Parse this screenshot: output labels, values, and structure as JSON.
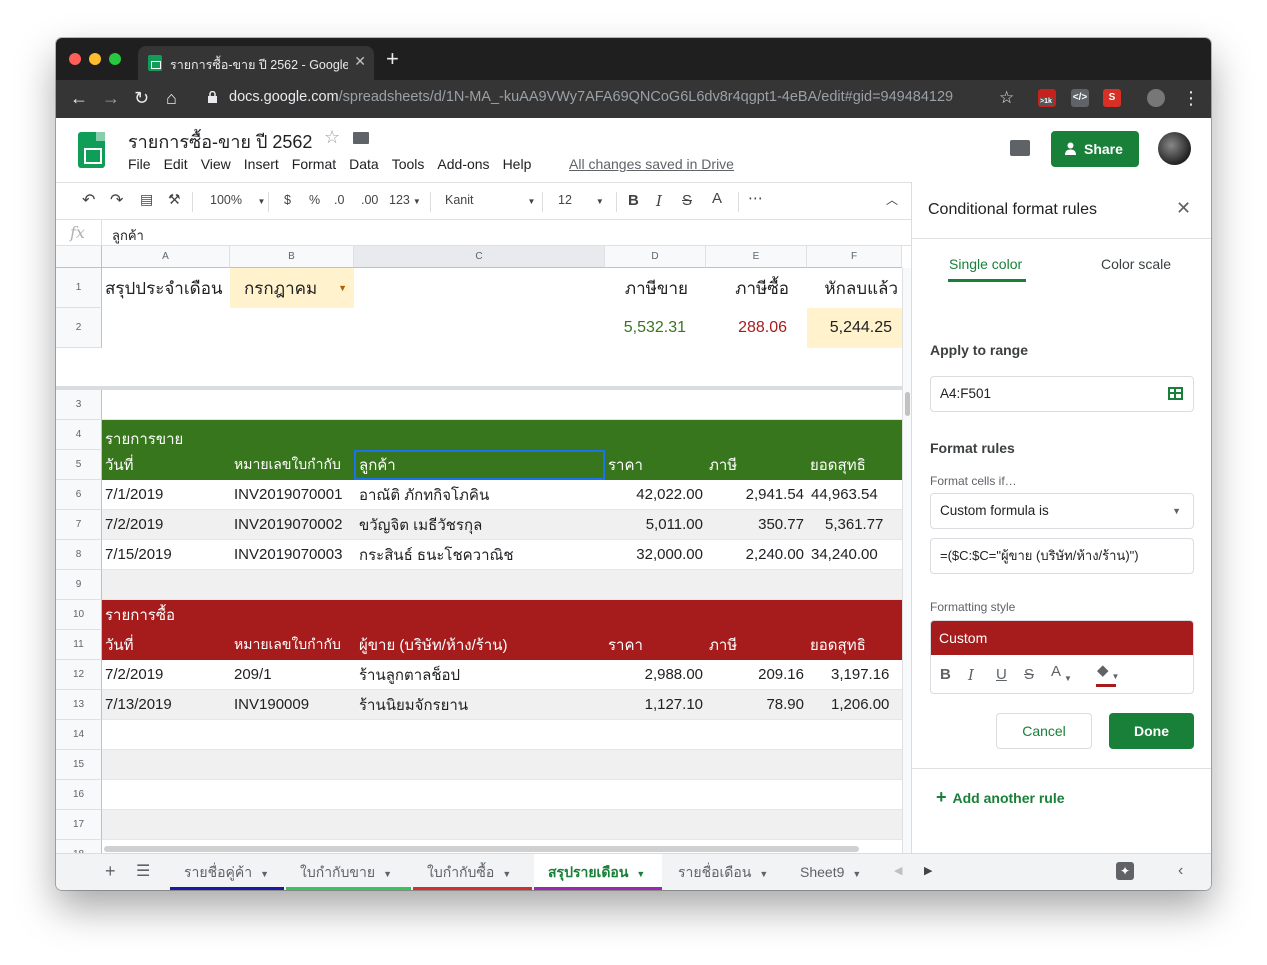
{
  "browser": {
    "tab_title": "รายการซื้อ-ขาย ปี 2562 - Google",
    "url_host": "docs.google.com",
    "url_path": "/spreadsheets/d/1N-MA_-kuAA9VWy7AFA69QNCoG6L6dv8r4qgpt1-4eBA/edit#gid=949484129",
    "ext_badge": ">1k"
  },
  "doc": {
    "title": "รายการซื้อ-ขาย ปี 2562",
    "menus": [
      "File",
      "Edit",
      "View",
      "Insert",
      "Format",
      "Data",
      "Tools",
      "Add-ons",
      "Help"
    ],
    "saved_status": "All changes saved in Drive",
    "share_label": "Share"
  },
  "toolbar": {
    "zoom": "100%",
    "currency": "$",
    "percent": "%",
    "dec_less": ".0",
    "dec_more": ".00",
    "format_more": "123",
    "font": "Kanit",
    "font_size": "12",
    "more": "⋯"
  },
  "formula_bar": {
    "fx": "fx",
    "value": "ลูกค้า"
  },
  "columns": [
    "A",
    "B",
    "C",
    "D",
    "E",
    "F"
  ],
  "rows": {
    "r1": {
      "a": "สรุปประจำเดือน",
      "b": "กรกฎาคม",
      "d": "ภาษีขาย",
      "e": "ภาษีซื้อ",
      "f": "หักลบแล้ว"
    },
    "r2": {
      "d": "5,532.31",
      "e": "288.06",
      "f": "5,244.25"
    },
    "r4": {
      "a": "รายการขาย"
    },
    "r5": {
      "a": "วันที่",
      "b": "หมายเลขใบกำกับ",
      "c": "ลูกค้า",
      "d": "ราคา",
      "e": "ภาษี",
      "f": "ยอดสุทธิ"
    },
    "r6": {
      "a": "7/1/2019",
      "b": "INV2019070001",
      "c": "อาณัติ ภักทกิจโภคิน",
      "d": "42,022.00",
      "e": "2,941.54",
      "f": "44,963.54"
    },
    "r7": {
      "a": "7/2/2019",
      "b": "INV2019070002",
      "c": "ขวัญจิต เมธีวัชรกุล",
      "d": "5,011.00",
      "e": "350.77",
      "f": "5,361.77"
    },
    "r8": {
      "a": "7/15/2019",
      "b": "INV2019070003",
      "c": "กระสินธ์ ธนะโชควาณิช",
      "d": "32,000.00",
      "e": "2,240.00",
      "f": "34,240.00"
    },
    "r10": {
      "a": "รายการซื้อ"
    },
    "r11": {
      "a": "วันที่",
      "b": "หมายเลขใบกำกับ",
      "c": "ผู้ขาย (บริษัท/ห้าง/ร้าน)",
      "d": "ราคา",
      "e": "ภาษี",
      "f": "ยอดสุทธิ"
    },
    "r12": {
      "a": "7/2/2019",
      "b": "209/1",
      "c": "ร้านลูกตาลช็อป",
      "d": "2,988.00",
      "e": "209.16",
      "f": "3,197.16"
    },
    "r13": {
      "a": "7/13/2019",
      "b": "INV190009",
      "c": "ร้านนิยมจักรยาน",
      "d": "1,127.10",
      "e": "78.90",
      "f": "1,206.00"
    }
  },
  "row_numbers": [
    "1",
    "2",
    "3",
    "4",
    "5",
    "6",
    "7",
    "8",
    "9",
    "10",
    "11",
    "12",
    "13",
    "14",
    "15",
    "16",
    "17",
    "18"
  ],
  "sheet_tabs": [
    {
      "label": "รายชื่อคู่ค้า",
      "color": "#1a1aa6"
    },
    {
      "label": "ใบกำกับขาย",
      "color": "#34c759"
    },
    {
      "label": "ใบกำกับซื้อ",
      "color": "#d32f2f"
    },
    {
      "label": "สรุปรายเดือน",
      "color": "#9c27b0"
    },
    {
      "label": "รายชื่อเดือน",
      "color": ""
    },
    {
      "label": "Sheet9",
      "color": ""
    }
  ],
  "panel": {
    "title": "Conditional format rules",
    "tab_single": "Single color",
    "tab_scale": "Color scale",
    "apply_label": "Apply to range",
    "range": "A4:F501",
    "rules_label": "Format rules",
    "cells_if": "Format cells if…",
    "condition": "Custom formula is",
    "formula": "=($C:$C=\"ผู้ขาย (บริษัท/ห้าง/ร้าน)\")",
    "style_label": "Formatting style",
    "style_name": "Custom",
    "cancel": "Cancel",
    "done": "Done",
    "add_rule": "Add another rule"
  },
  "colors": {
    "green_band": "#38761d",
    "red_band": "#a61c1c",
    "accent": "#188038",
    "highlight": "#fff2cc"
  }
}
